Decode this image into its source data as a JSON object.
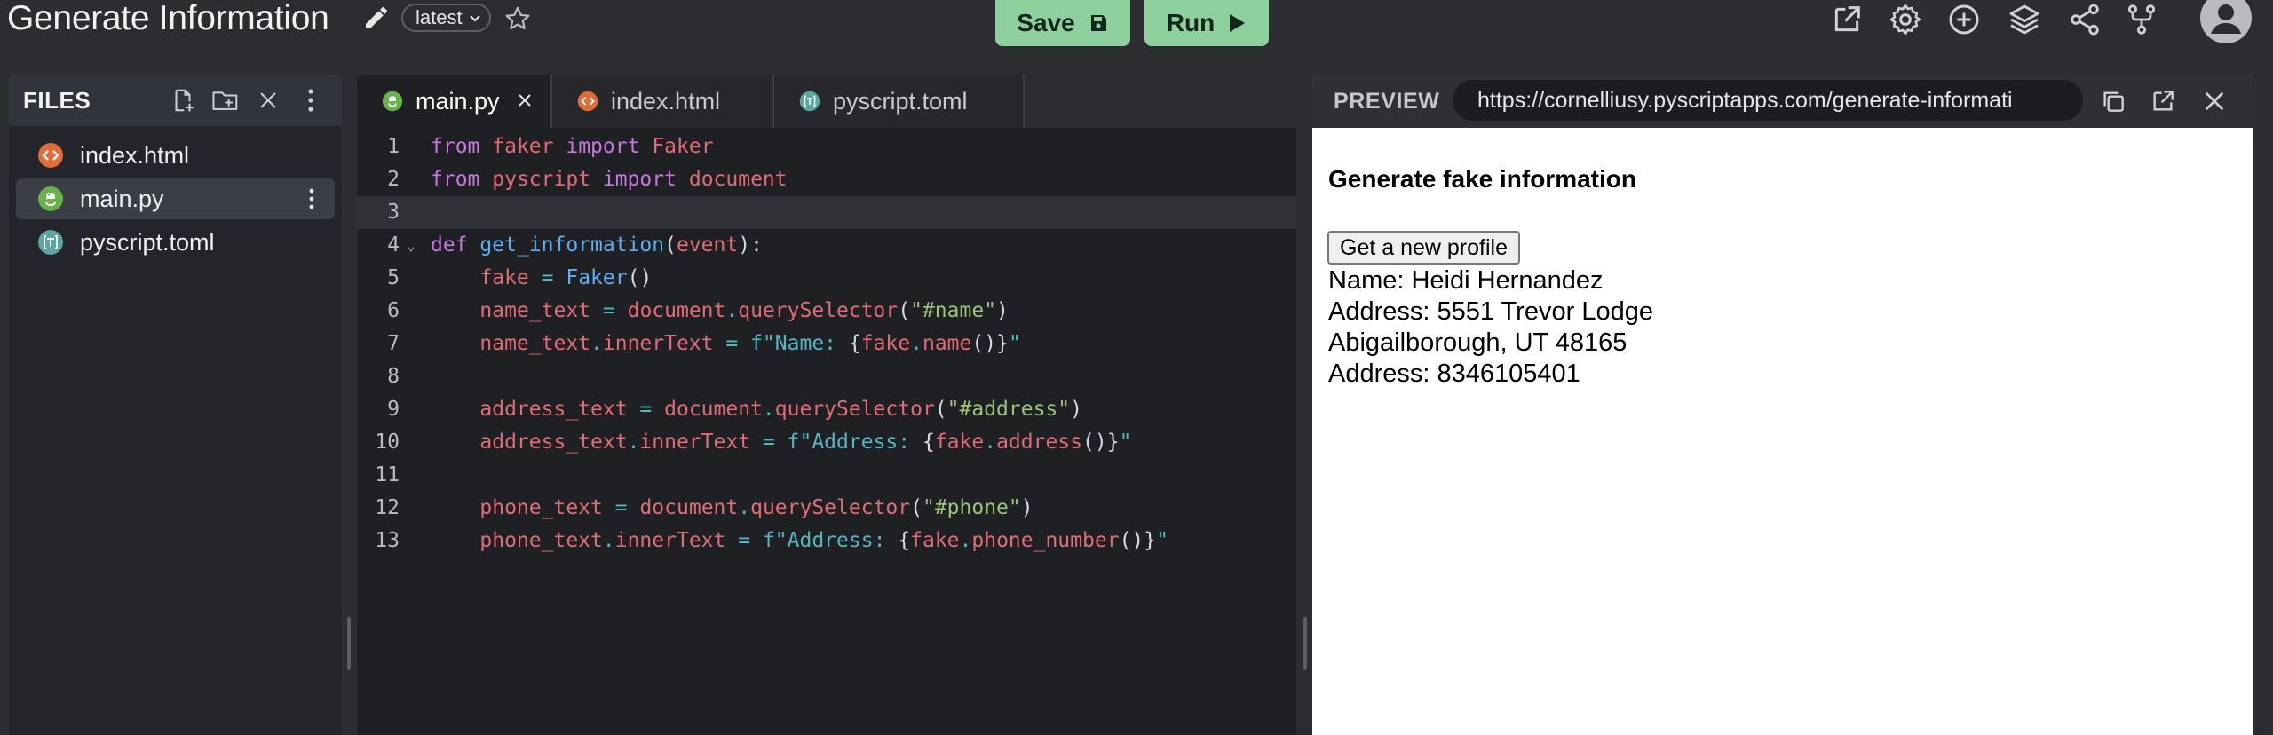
{
  "topbar": {
    "title": "Generate Information",
    "version": "latest",
    "save_label": "Save",
    "run_label": "Run"
  },
  "files": {
    "header": "FILES",
    "items": [
      {
        "label": "index.html",
        "icon": "html-file-icon"
      },
      {
        "label": "main.py",
        "icon": "python-file-icon"
      },
      {
        "label": "pyscript.toml",
        "icon": "toml-file-icon"
      }
    ],
    "selected": "main.py"
  },
  "editor": {
    "tabs": [
      {
        "label": "main.py",
        "icon": "python-file-icon"
      },
      {
        "label": "index.html",
        "icon": "html-file-icon"
      },
      {
        "label": "pyscript.toml",
        "icon": "toml-file-icon"
      }
    ],
    "active_tab": "main.py",
    "lines": [
      "from faker import Faker",
      "from pyscript import document",
      "",
      "def get_information(event):",
      "    fake = Faker()",
      "    name_text = document.querySelector(\"#name\")",
      "    name_text.innerText = f\"Name: {fake.name()}\"",
      "",
      "    address_text = document.querySelector(\"#address\")",
      "    address_text.innerText = f\"Address: {fake.address()}\"",
      "",
      "    phone_text = document.querySelector(\"#phone\")",
      "    phone_text.innerText = f\"Address: {fake.phone_number()}\""
    ],
    "highlighted_line": 3
  },
  "preview": {
    "header": "PREVIEW",
    "url": "https://cornelliusy.pyscriptapps.com/generate-informati",
    "heading": "Generate fake information",
    "button_label": "Get a new profile",
    "lines": [
      "Name: Heidi Hernandez",
      "Address: 5551 Trevor Lodge",
      "Abigailborough, UT 48165",
      "Address: 8346105401"
    ]
  },
  "colors": {
    "accent_green": "#8fd19e",
    "background": "#2b2d31",
    "editor_bg": "#1f2024"
  }
}
